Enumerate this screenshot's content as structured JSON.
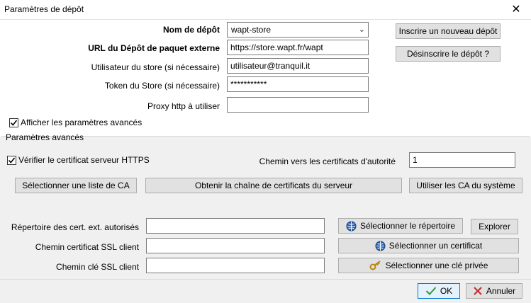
{
  "window": {
    "title": "Paramètres de dépôt"
  },
  "repo": {
    "name_label": "Nom de dépôt",
    "name_value": "wapt-store",
    "url_label": "URL du Dépôt de paquet externe",
    "url_value": "https://store.wapt.fr/wapt",
    "user_label": "Utilisateur du store (si nécessaire)",
    "user_value": "utilisateur@tranquil.it",
    "token_label": "Token du Store (si nécessaire)",
    "token_value": "***********",
    "proxy_label": "Proxy http à utiliser",
    "proxy_value": "",
    "register_button": "Inscrire un nouveau dépôt",
    "unregister_button": "Désinscrire le dépôt ?"
  },
  "advanced_toggle": {
    "label": "Afficher les paramètres avancés",
    "checked": true
  },
  "advanced": {
    "section_title": "Paramètres avancés",
    "verify_label": "Vérifier le certificat serveur HTTPS",
    "verify_checked": true,
    "ca_path_label": "Chemin vers les certificats d'autorité",
    "ca_path_value": "1",
    "select_ca_list": "Sélectionner une liste de CA",
    "get_server_chain": "Obtenir la chaîne de certificats du serveur",
    "use_system_ca": "Utiliser les CA du système",
    "cert_dir_label": "Répertoire des cert. ext. autorisés",
    "cert_dir_value": "",
    "ssl_cert_label": "Chemin certificat SSL client",
    "ssl_cert_value": "",
    "ssl_key_label": "Chemin clé SSL client",
    "ssl_key_value": "",
    "select_dir_button": "Sélectionner le répertoire",
    "explore_button": "Explorer",
    "select_cert_button": "Sélectionner un certificat",
    "select_key_button": "Sélectionner une clé privée"
  },
  "footer": {
    "ok_label": "OK",
    "cancel_label": "Annuler"
  },
  "colors": {
    "ok_border": "#0078d7",
    "check_green": "#2e9a3a",
    "cancel_red": "#c62828"
  }
}
